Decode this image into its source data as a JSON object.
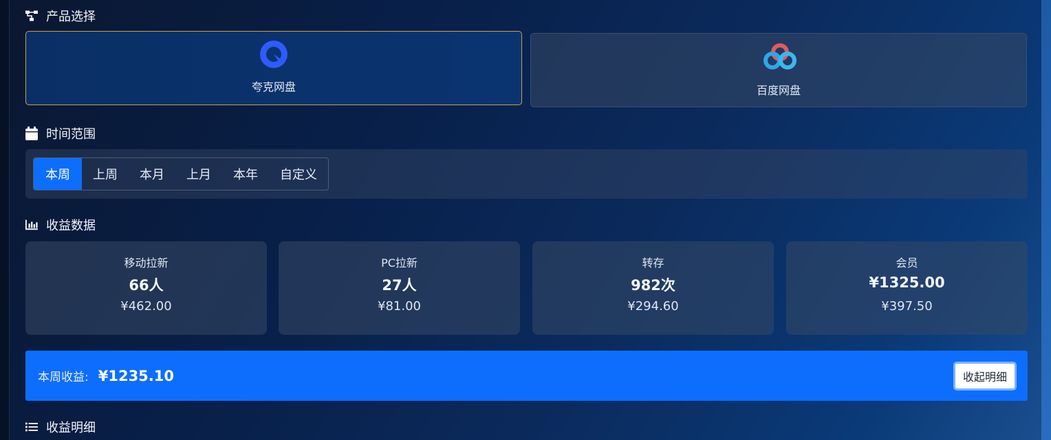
{
  "sections": {
    "product_title": "产品选择",
    "time_title": "时间范围",
    "data_title": "收益数据",
    "detail_title": "收益明细"
  },
  "products": [
    {
      "name": "夸克网盘",
      "selected": true,
      "icon": "quark-logo"
    },
    {
      "name": "百度网盘",
      "selected": false,
      "icon": "baidu-netdisk-logo"
    }
  ],
  "time_tabs": [
    {
      "label": "本周",
      "active": true
    },
    {
      "label": "上周",
      "active": false
    },
    {
      "label": "本月",
      "active": false
    },
    {
      "label": "上月",
      "active": false
    },
    {
      "label": "本年",
      "active": false
    },
    {
      "label": "自定义",
      "active": false
    }
  ],
  "stats": [
    {
      "label": "移动拉新",
      "count": "66人",
      "amount": "¥462.00"
    },
    {
      "label": "PC拉新",
      "count": "27人",
      "amount": "¥81.00"
    },
    {
      "label": "转存",
      "count": "982次",
      "amount": "¥294.60"
    },
    {
      "label": "会员",
      "count": "¥1325.00",
      "amount": "¥397.50"
    }
  ],
  "summary": {
    "label": "本周收益:",
    "value": "¥1235.10",
    "collapse_button": "收起明细"
  },
  "colors": {
    "accent": "#0d6efd",
    "selected_border": "#c9a24a"
  }
}
